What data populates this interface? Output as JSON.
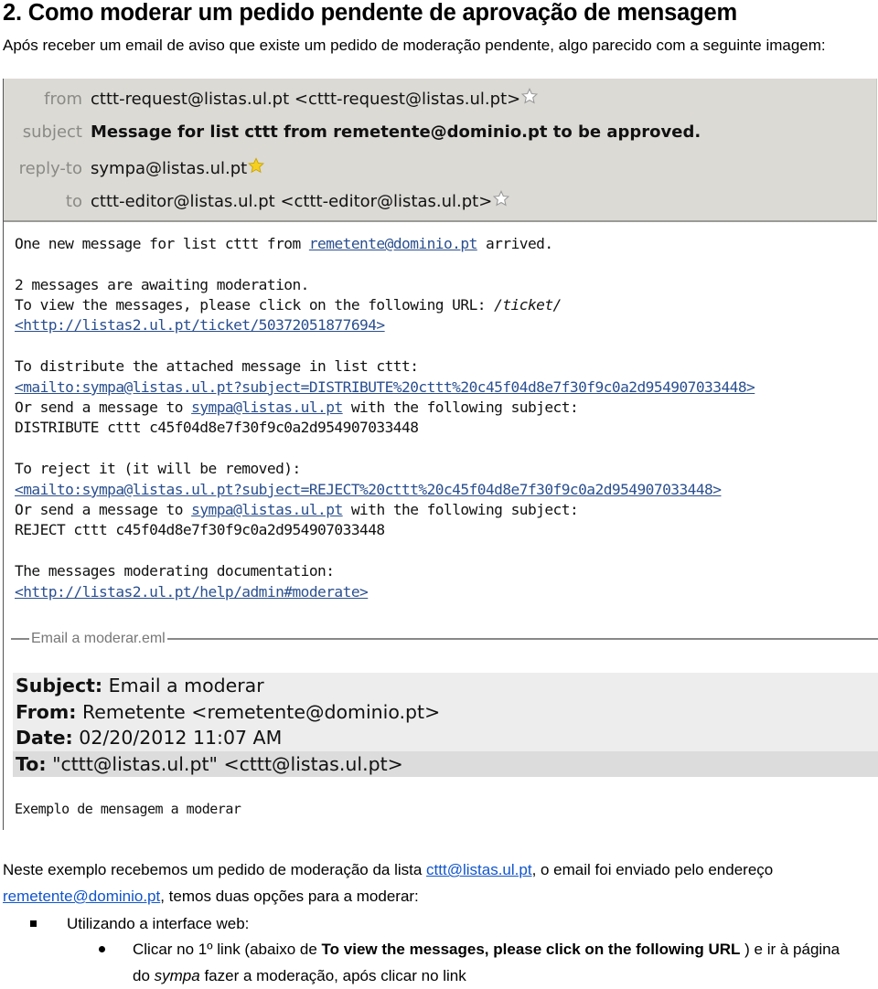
{
  "document": {
    "title": "2. Como moderar um pedido pendente de aprovação de mensagem",
    "intro": "Após receber um email de aviso que existe um pedido de moderação pendente, algo parecido com a seguinte imagem:"
  },
  "screenshot": {
    "header": {
      "from_label": "from",
      "from_value": "cttt-request@listas.ul.pt <cttt-request@listas.ul.pt>",
      "subject_label": "subject",
      "subject_value": "Message for list cttt from remetente@dominio.pt to be approved.",
      "replyto_label": "reply-to",
      "replyto_value": "sympa@listas.ul.pt",
      "to_label": "to",
      "to_value": "cttt-editor@listas.ul.pt <cttt-editor@listas.ul.pt>",
      "star_icons": [
        "star-outline",
        "star-filled-yellow",
        "star-outline"
      ]
    },
    "body": {
      "line1_pre": "One new message for list cttt from ",
      "line1_link": "remetente@dominio.pt",
      "line1_post": " arrived.",
      "awaiting": "2 messages are awaiting moderation.",
      "view_pre": "To view the messages, please click on the following URL: ",
      "view_italic": "/ticket/",
      "ticket_link": "<http://listas2.ul.pt/ticket/50372051877694>",
      "distribute_intro": "To distribute the attached message in list cttt:",
      "distribute_link": "<mailto:sympa@listas.ul.pt?subject=DISTRIBUTE%20cttt%20c45f04d8e7f30f9c0a2d954907033448>",
      "or_send_pre": "Or send a message to ",
      "or_send_link": "sympa@listas.ul.pt",
      "or_send_post": " with the following subject:",
      "distribute_subject": "DISTRIBUTE cttt c45f04d8e7f30f9c0a2d954907033448",
      "reject_intro": "To reject it (it will be removed):",
      "reject_link": "<mailto:sympa@listas.ul.pt?subject=REJECT%20cttt%20c45f04d8e7f30f9c0a2d954907033448>",
      "reject_subject": "REJECT cttt c45f04d8e7f30f9c0a2d954907033448",
      "doc_intro": "The messages moderating documentation:",
      "doc_link": "<http://listas2.ul.pt/help/admin#moderate>"
    },
    "attachment": {
      "name": "Email a moderar.eml",
      "subject_label": "Subject:",
      "subject_value": " Email a moderar",
      "from_label": "From:",
      "from_value": " Remetente <remetente@dominio.pt>",
      "date_label": "Date:",
      "date_value": " 02/20/2012 11:07 AM",
      "to_label": "To:",
      "to_value": " \"cttt@listas.ul.pt\" <cttt@listas.ul.pt>",
      "body": "Exemplo de mensagem a moderar"
    }
  },
  "paragraph": {
    "p1_a": "Neste exemplo recebemos um pedido de moderação da lista ",
    "p1_link": "cttt@listas.ul.pt",
    "p1_b": ", o email foi enviado pelo endereço ",
    "p1_link2": "remetente@dominio.pt",
    "p1_c": ", temos duas opções para a moderar:"
  },
  "list": {
    "item1": "Utilizando a interface web:",
    "sub1_a": "Clicar no 1º link (abaixo de ",
    "sub1_bold": "To view the messages, please click on the following URL",
    "sub1_b": " ) e ir à página do ",
    "sub1_italic": "sympa",
    "sub1_c": " fazer a moderação, após clicar no link"
  },
  "colors": {
    "header_bg": "#dcdad5",
    "mail_link": "#2a4f8f",
    "doc_link": "#1155cc",
    "star_yellow": "#f5d020"
  }
}
